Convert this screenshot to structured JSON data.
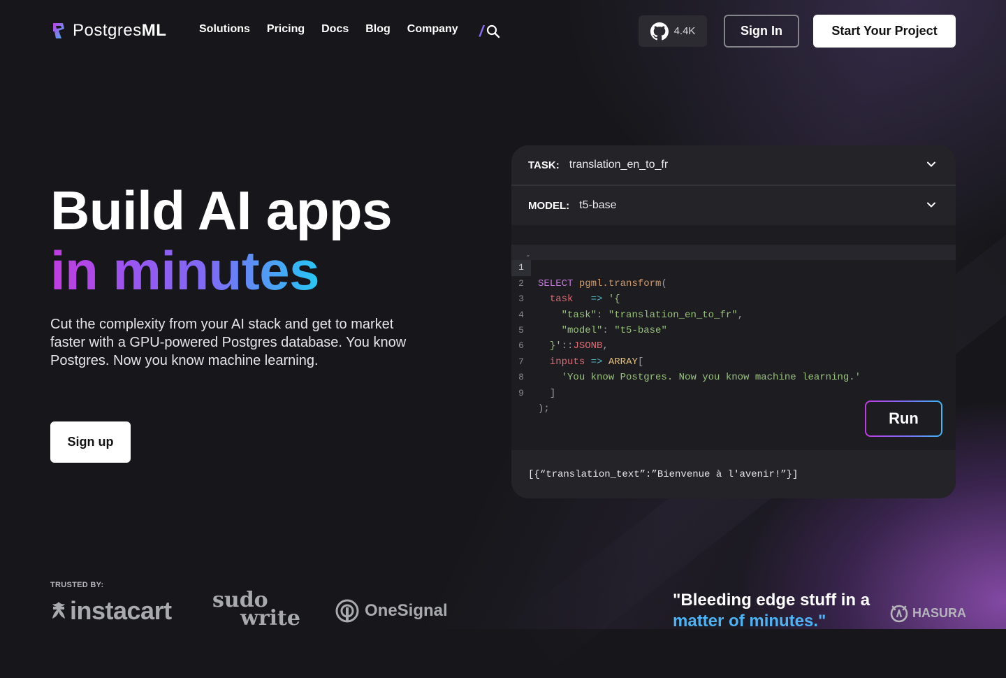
{
  "nav": {
    "brand_regular": "Postgres",
    "brand_bold": "ML",
    "links": [
      "Solutions",
      "Pricing",
      "Docs",
      "Blog",
      "Company"
    ],
    "search_slash": "/",
    "github_count": "4.4K",
    "signin_label": "Sign In",
    "start_label": "Start Your Project"
  },
  "hero": {
    "title_line1": "Build AI apps",
    "title_line2": "in minutes",
    "subtitle": "Cut the complexity from your AI stack and get to market faster with a GPU-powered Postgres database. You know Postgres. Now you know machine learning.",
    "signup_label": "Sign up"
  },
  "demo": {
    "task_label": "TASK:",
    "task_value": "translation_en_to_fr",
    "model_label": "MODEL:",
    "model_value": "t5-base",
    "line_numbers": [
      "1",
      "2",
      "3",
      "4",
      "5",
      "6",
      "7",
      "8",
      "9"
    ],
    "code": {
      "l1_kw": "SELECT",
      "l1_fn": "pgml.transform",
      "l1_p": "(",
      "l2_id": "task",
      "l2_op": "=>",
      "l2_st": "'{",
      "l3_st": "\"task\"",
      "l3_p": ":",
      "l3_st2": "\"translation_en_to_fr\"",
      "l3_p2": ",",
      "l4_st": "\"model\"",
      "l4_p": ":",
      "l4_st2": "\"t5-base\"",
      "l5_st": "}'",
      "l5_p": "::",
      "l5_id": "JSONB",
      "l5_p2": ",",
      "l6_id": "inputs",
      "l6_op": "=>",
      "l6_ty": "ARRAY",
      "l6_p": "[",
      "l7_st": "'You know Postgres. Now you know machine learning.'",
      "l8_p": "]",
      "l9_p": ");"
    },
    "run_label": "Run",
    "result": "[{“translation_text”:”Bienvenue à l'avenir!”}]"
  },
  "trusted": {
    "label": "TRUSTED BY:",
    "logos": [
      "instacart",
      "sudo",
      "write",
      "OneSignal",
      "HASURA"
    ]
  },
  "quote": {
    "line1": "\"Bleeding edge stuff in a",
    "line2": "matter of minutes.\""
  },
  "colors": {
    "background": "#17171b",
    "gradient_start": "#c23ce0",
    "gradient_end": "#26c8f5",
    "quote_accent": "#4cb3f5"
  }
}
